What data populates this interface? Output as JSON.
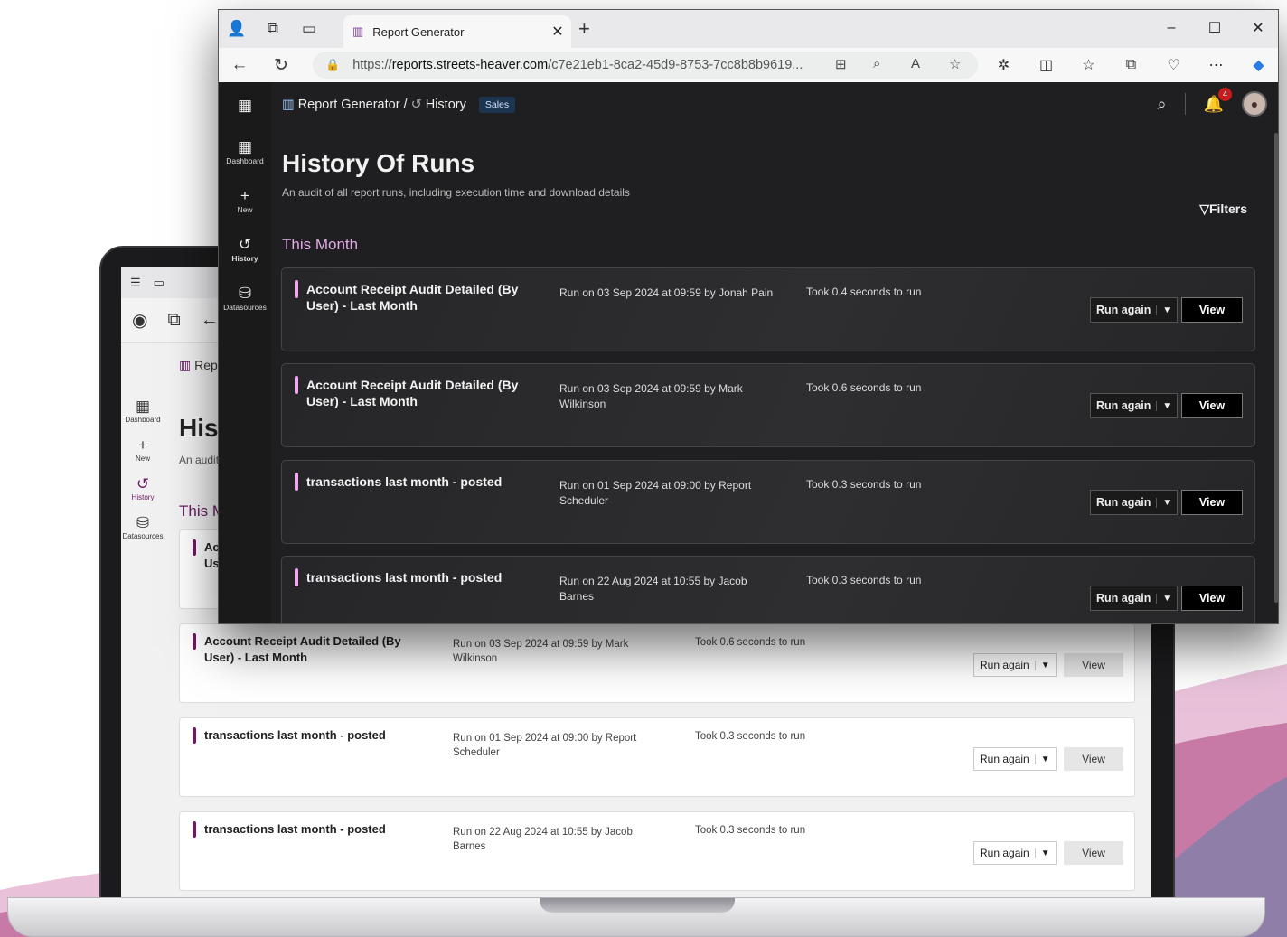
{
  "browser": {
    "tab_title": "Report Generator",
    "url_prefix": "https://",
    "url_domain": "reports.streets-heaver.com",
    "url_path": "/c7e21eb1-8ca2-45d9-8753-7cc8b8b9619...",
    "window_controls": [
      "–",
      "☐",
      "✕"
    ]
  },
  "app": {
    "breadcrumb_root": "Report Generator",
    "breadcrumb_sep": "/",
    "breadcrumb_current": "History",
    "badge": "Sales",
    "notification_count": "4",
    "rail": [
      {
        "label": "Dashboard",
        "icon": "grid-icon"
      },
      {
        "label": "New",
        "icon": "plus-icon"
      },
      {
        "label": "History",
        "icon": "history-icon"
      },
      {
        "label": "Datasources",
        "icon": "database-icon"
      }
    ],
    "title": "History Of Runs",
    "subtitle": "An audit of all report runs, including execution time and download details",
    "filters_label": "Filters",
    "section": "This Month",
    "run_again_label": "Run again",
    "view_label": "View",
    "runs": [
      {
        "name": "Account Receipt Audit Detailed (By User) - Last Month",
        "run": "Run on 03 Sep 2024 at 09:59 by Jonah Pain",
        "took": "Took 0.4 seconds to run"
      },
      {
        "name": "Account Receipt Audit Detailed (By User) - Last Month",
        "run": "Run on 03 Sep 2024 at 09:59 by Mark Wilkinson",
        "took": "Took 0.6 seconds to run"
      },
      {
        "name": "transactions last month - posted",
        "run": "Run on 01 Sep 2024 at 09:00 by Report Scheduler",
        "took": "Took 0.3 seconds to run"
      },
      {
        "name": "transactions last month - posted",
        "run": "Run on 22 Aug 2024 at 10:55 by Jacob Barnes",
        "took": "Took 0.3 seconds to run"
      }
    ]
  },
  "laptop": {
    "breadcrumb_partial": "Rep",
    "title_partial": "Hist",
    "subtitle_partial": "An audit",
    "section_partial": "This M",
    "first_card_partial_1": "Acc",
    "first_card_partial_2": "Us",
    "rail": [
      "Dashboard",
      "New",
      "History",
      "Datasources"
    ]
  },
  "colors": {
    "accent_dark": "#f0a7f0",
    "accent_light": "#6a1b64",
    "badge_bg": "#1d3550",
    "notification": "#c91b1b"
  }
}
